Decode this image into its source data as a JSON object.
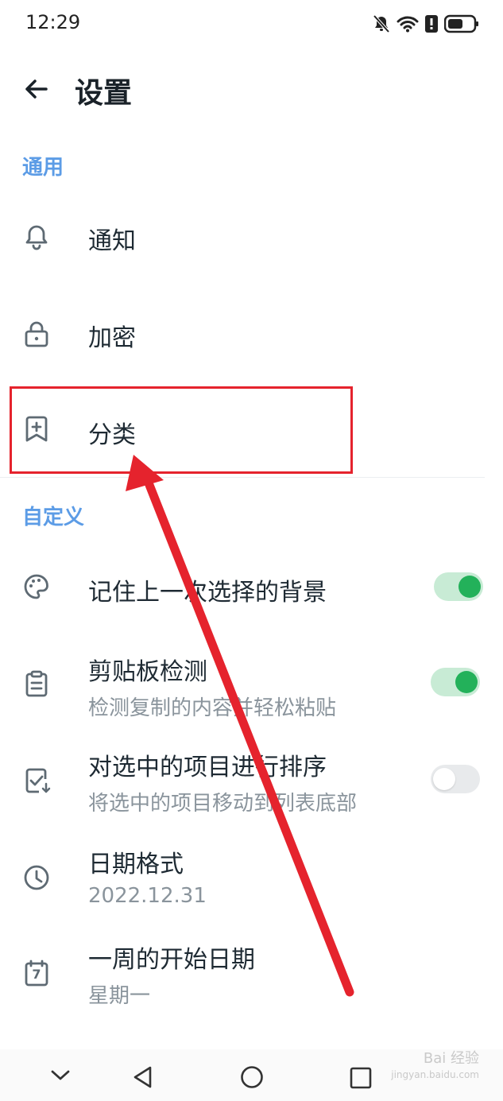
{
  "status_bar": {
    "time": "12:29",
    "icons": [
      "mute-bell-icon",
      "wifi-icon",
      "alert-icon",
      "battery-icon"
    ]
  },
  "header": {
    "title": "设置",
    "back_icon": "arrow-left-icon"
  },
  "sections": {
    "general": "通用",
    "custom": "自定义"
  },
  "general_items": [
    {
      "icon": "bell-icon",
      "title": "通知"
    },
    {
      "icon": "lock-icon",
      "title": "加密"
    },
    {
      "icon": "bookmark-plus-icon",
      "title": "分类"
    }
  ],
  "custom_items": [
    {
      "icon": "palette-icon",
      "title": "记住上一次选择的背景",
      "toggle": true
    },
    {
      "icon": "clipboard-icon",
      "title": "剪贴板检测",
      "subtitle": "检测复制的内容并轻松粘贴",
      "toggle": true
    },
    {
      "icon": "checkbox-sort-icon",
      "title": "对选中的项目进行排序",
      "subtitle": "将选中的项目移动到列表底部",
      "toggle": false
    },
    {
      "icon": "clock-icon",
      "title": "日期格式",
      "subtitle": "2022.12.31"
    },
    {
      "icon": "calendar-icon",
      "title": "一周的开始日期",
      "subtitle": "星期一",
      "calendar_day": "7"
    }
  ],
  "nav_bar": [
    "chevron-down-icon",
    "back-triangle-icon",
    "home-circle-icon",
    "recents-square-icon"
  ],
  "watermark": {
    "main": "Bai 经验",
    "sub": "jingyan.baidu.com"
  },
  "colors": {
    "accent": "#5c9ce6",
    "toggle_on": "#23b15a",
    "highlight": "#e5232d",
    "arrow": "#e5232d"
  }
}
